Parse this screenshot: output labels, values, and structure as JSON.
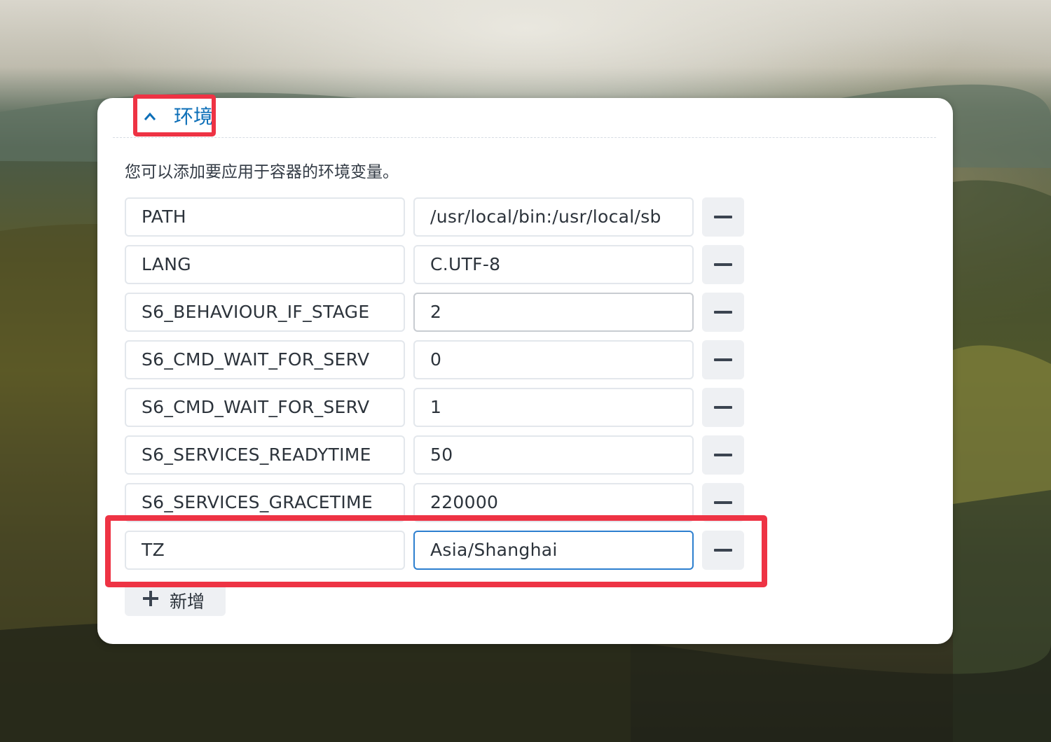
{
  "section": {
    "title": "环境",
    "description": "您可以添加要应用于容器的环境变量。"
  },
  "env_vars": [
    {
      "key": "PATH",
      "value": "/usr/local/bin:/usr/local/sb"
    },
    {
      "key": "LANG",
      "value": "C.UTF-8"
    },
    {
      "key": "S6_BEHAVIOUR_IF_STAGE",
      "value": "2"
    },
    {
      "key": "S6_CMD_WAIT_FOR_SERV",
      "value": "0"
    },
    {
      "key": "S6_CMD_WAIT_FOR_SERV",
      "value": "1"
    },
    {
      "key": "S6_SERVICES_READYTIME",
      "value": "50"
    },
    {
      "key": "S6_SERVICES_GRACETIME",
      "value": "220000"
    },
    {
      "key": "TZ",
      "value": "Asia/Shanghai"
    }
  ],
  "add_button": {
    "label": "新增"
  },
  "colors": {
    "accent": "#0d6fb8",
    "highlight": "#ee3344",
    "focus_border": "#2d7fcf"
  }
}
